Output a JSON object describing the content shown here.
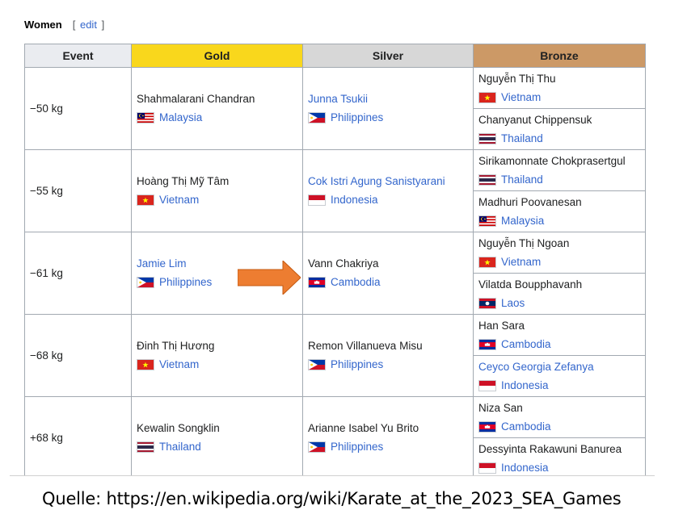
{
  "section": {
    "title": "Women",
    "edit_label": "edit",
    "bracket_open": "[",
    "bracket_close": "]"
  },
  "headers": {
    "event": "Event",
    "gold": "Gold",
    "silver": "Silver",
    "bronze": "Bronze"
  },
  "colors": {
    "gold": "#f9d71c",
    "silver": "#d7d7d7",
    "bronze": "#cc9966",
    "link": "#3366cc",
    "arrow": "#ed7d31"
  },
  "rows": [
    {
      "event": "−50 kg",
      "gold": {
        "name": "Shahmalarani Chandran",
        "country": "Malaysia",
        "flag": "malaysia-flag-icon"
      },
      "silver": {
        "name": "Junna Tsukii",
        "country": "Philippines",
        "flag": "philippines-flag-icon"
      },
      "bronze": [
        {
          "name": "Nguyễn Thị Thu",
          "country": "Vietnam",
          "flag": "vietnam-flag-icon"
        },
        {
          "name": "Chanyanut Chippensuk",
          "country": "Thailand",
          "flag": "thailand-flag-icon"
        }
      ]
    },
    {
      "event": "−55 kg",
      "gold": {
        "name": "Hoàng Thị Mỹ Tâm",
        "country": "Vietnam",
        "flag": "vietnam-flag-icon"
      },
      "silver": {
        "name": "Cok Istri Agung Sanistyarani",
        "country": "Indonesia",
        "flag": "indonesia-flag-icon"
      },
      "bronze": [
        {
          "name": "Sirikamonnate Chokprasertgul",
          "country": "Thailand",
          "flag": "thailand-flag-icon"
        },
        {
          "name": "Madhuri Poovanesan",
          "country": "Malaysia",
          "flag": "malaysia-flag-icon"
        }
      ]
    },
    {
      "event": "−61 kg",
      "gold": {
        "name": "Jamie Lim",
        "country": "Philippines",
        "flag": "philippines-flag-icon"
      },
      "silver": {
        "name": "Vann Chakriya",
        "country": "Cambodia",
        "flag": "cambodia-flag-icon"
      },
      "bronze": [
        {
          "name": "Nguyễn Thị Ngoan",
          "country": "Vietnam",
          "flag": "vietnam-flag-icon"
        },
        {
          "name": "Vilatda Boupphavanh",
          "country": "Laos",
          "flag": "laos-flag-icon"
        }
      ]
    },
    {
      "event": "−68 kg",
      "gold": {
        "name": "Đinh Thị Hương",
        "country": "Vietnam",
        "flag": "vietnam-flag-icon"
      },
      "silver": {
        "name": "Remon Villanueva Misu",
        "country": "Philippines",
        "flag": "philippines-flag-icon"
      },
      "bronze": [
        {
          "name": "Han Sara",
          "country": "Cambodia",
          "flag": "cambodia-flag-icon"
        },
        {
          "name": "Ceyco Georgia Zefanya",
          "country": "Indonesia",
          "flag": "indonesia-flag-icon"
        }
      ]
    },
    {
      "event": "+68 kg",
      "gold": {
        "name": "Kewalin Songklin",
        "country": "Thailand",
        "flag": "thailand-flag-icon"
      },
      "silver": {
        "name": "Arianne Isabel Yu Brito",
        "country": "Philippines",
        "flag": "philippines-flag-icon"
      },
      "bronze": [
        {
          "name": "Niza San",
          "country": "Cambodia",
          "flag": "cambodia-flag-icon"
        },
        {
          "name": "Dessyinta Rakawuni Banurea",
          "country": "Indonesia",
          "flag": "indonesia-flag-icon"
        }
      ]
    }
  ],
  "source": "Quelle: https://en.wikipedia.org/wiki/Karate_at_the_2023_SEA_Games"
}
